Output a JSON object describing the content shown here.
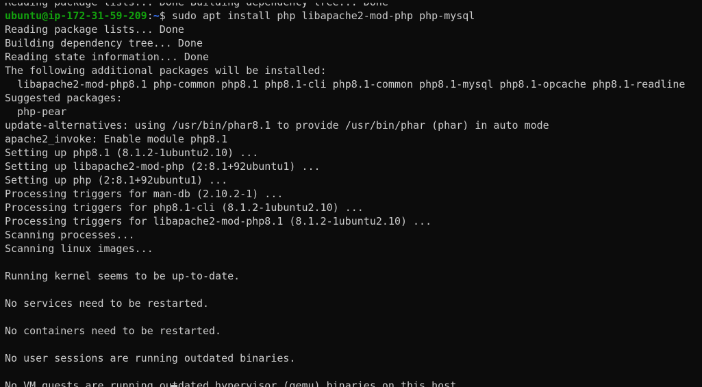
{
  "terminal": {
    "partial_top": "Reading package lists... Done Building dependency tree... Done",
    "prompt": {
      "user_host": "ubuntu@ip-172-31-59-209",
      "separator": ":",
      "path": "~",
      "symbol": "$ ",
      "command": "sudo apt install php libapache2-mod-php php-mysql"
    },
    "output": [
      "Reading package lists... Done",
      "Building dependency tree... Done",
      "Reading state information... Done",
      "The following additional packages will be installed:",
      "  libapache2-mod-php8.1 php-common php8.1 php8.1-cli php8.1-common php8.1-mysql php8.1-opcache php8.1-readline",
      "Suggested packages:",
      "  php-pear",
      "update-alternatives: using /usr/bin/phar8.1 to provide /usr/bin/phar (phar) in auto mode",
      "apache2_invoke: Enable module php8.1",
      "Setting up php8.1 (8.1.2-1ubuntu2.10) ...",
      "Setting up libapache2-mod-php (2:8.1+92ubuntu1) ...",
      "Setting up php (2:8.1+92ubuntu1) ...",
      "Processing triggers for man-db (2.10.2-1) ...",
      "Processing triggers for php8.1-cli (8.1.2-1ubuntu2.10) ...",
      "Processing triggers for libapache2-mod-php8.1 (8.1.2-1ubuntu2.10) ...",
      "Scanning processes...",
      "Scanning linux images...",
      "",
      "Running kernel seems to be up-to-date.",
      "",
      "No services need to be restarted.",
      "",
      "No containers need to be restarted.",
      "",
      "No user sessions are running outdated binaries.",
      "",
      "No VM guests are running outdated hypervisor (qemu) binaries on this host."
    ]
  },
  "colors": {
    "background": "#0c0c0c",
    "text": "#cccccc",
    "prompt_user": "#13a10e",
    "prompt_path": "#3b78ff"
  }
}
